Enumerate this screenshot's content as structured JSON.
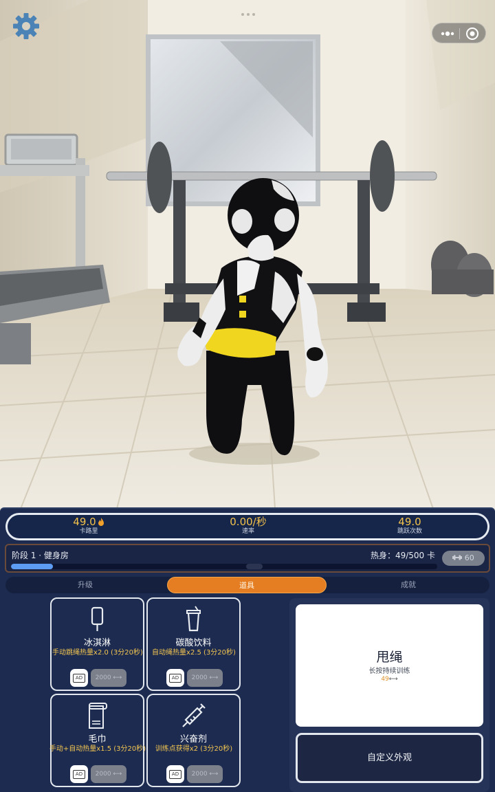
{
  "top": {
    "settings_icon": "gear-icon",
    "capsule_icons": [
      "more-dots-icon",
      "close-circle-icon"
    ]
  },
  "stats": {
    "calories": {
      "value": "49.0",
      "label": "卡路里",
      "icon": "flame-icon"
    },
    "rate": {
      "value": "0.00/秒",
      "label": "速率"
    },
    "jumps": {
      "value": "49.0",
      "label": "跳跃次数"
    }
  },
  "stage": {
    "title": "阶段 1 · 健身房",
    "warmup": "热身：49/500 卡",
    "progress": 0.098,
    "badge_value": "60",
    "badge_icon": "dumbbell-icon"
  },
  "tabs": [
    {
      "label": "升级",
      "active": false
    },
    {
      "label": "道具",
      "active": true
    },
    {
      "label": "成就",
      "active": false
    }
  ],
  "items": [
    {
      "name": "冰淇淋",
      "desc": "手动跳绳热量x2.0 (3分20秒)",
      "icon": "ice-cream-icon",
      "ad": "AD",
      "price": "2000"
    },
    {
      "name": "碳酸饮料",
      "desc": "自动绳热量x2.5 (3分20秒)",
      "icon": "soda-cup-icon",
      "ad": "AD",
      "price": "2000"
    },
    {
      "name": "毛巾",
      "desc": "手动+自动热量x1.5 (3分20秒)",
      "icon": "towel-icon",
      "ad": "AD",
      "price": "2000"
    },
    {
      "name": "兴奋剂",
      "desc": "训练点获得x2 (3分20秒)",
      "icon": "syringe-icon",
      "ad": "AD",
      "price": "2000"
    }
  ],
  "rope": {
    "title": "甩绳",
    "subtitle": "长按持续训练",
    "value": "49"
  },
  "custom_button": "自定义外观",
  "colors": {
    "panel": "#1c2b4f",
    "accent_orange": "#e57d22",
    "gold": "#f4c651",
    "progress_blue": "#5c9cf2"
  }
}
